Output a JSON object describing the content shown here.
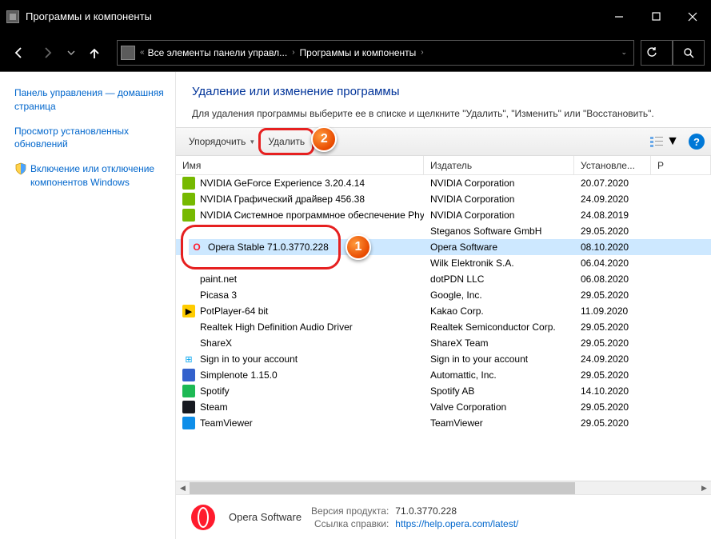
{
  "window": {
    "title": "Программы и компоненты"
  },
  "breadcrumb": {
    "item1": "Все элементы панели управл...",
    "item2": "Программы и компоненты"
  },
  "sidebar": {
    "item0": "Панель управления — домашняя страница",
    "item1": "Просмотр установленных обновлений",
    "item2": "Включение или отключение компонентов Windows"
  },
  "header": {
    "title": "Удаление или изменение программы",
    "desc": "Для удаления программы выберите ее в списке и щелкните \"Удалить\", \"Изменить\" или \"Восстановить\"."
  },
  "toolbar": {
    "organize": "Упорядочить",
    "delete": "Удалить"
  },
  "columns": {
    "name": "Имя",
    "publisher": "Издатель",
    "installed": "Установле...",
    "r": "Р"
  },
  "programs": [
    {
      "name": "NVIDIA GeForce Experience 3.20.4.14",
      "publisher": "NVIDIA Corporation",
      "date": "20.07.2020",
      "iconBg": "#76b900",
      "iconTxt": "",
      "iconColor": "#fff"
    },
    {
      "name": "NVIDIA Графический драйвер 456.38",
      "publisher": "NVIDIA Corporation",
      "date": "24.09.2020",
      "iconBg": "#76b900",
      "iconTxt": "",
      "iconColor": "#fff"
    },
    {
      "name": "NVIDIA Системное программное обеспечение Phy...",
      "publisher": "NVIDIA Corporation",
      "date": "24.08.2019",
      "iconBg": "#76b900",
      "iconTxt": "",
      "iconColor": "#fff"
    },
    {
      "name": "",
      "publisher": "Steganos Software GmbH",
      "date": "29.05.2020",
      "iconBg": "#ffffff",
      "iconTxt": "",
      "iconColor": "#000",
      "obscured": true
    },
    {
      "name": "Opera Stable 71.0.3770.228",
      "publisher": "Opera Software",
      "date": "08.10.2020",
      "iconBg": "#ffffff",
      "iconTxt": "O",
      "iconColor": "#ff1b2d",
      "selected": true
    },
    {
      "name": "",
      "publisher": "Wilk Elektronik S.A.",
      "date": "06.04.2020",
      "iconBg": "#ffffff",
      "iconTxt": "",
      "iconColor": "#000",
      "obscured": true
    },
    {
      "name": "paint.net",
      "publisher": "dotPDN LLC",
      "date": "06.08.2020",
      "iconBg": "#ffffff",
      "iconTxt": "",
      "iconColor": "#3a6ea5"
    },
    {
      "name": "Picasa 3",
      "publisher": "Google, Inc.",
      "date": "29.05.2020",
      "iconBg": "#ffffff",
      "iconTxt": "",
      "iconColor": "#f4b400"
    },
    {
      "name": "PotPlayer-64 bit",
      "publisher": "Kakao Corp.",
      "date": "11.09.2020",
      "iconBg": "#ffcc00",
      "iconTxt": "▶",
      "iconColor": "#000"
    },
    {
      "name": "Realtek High Definition Audio Driver",
      "publisher": "Realtek Semiconductor Corp.",
      "date": "29.05.2020",
      "iconBg": "#ffffff",
      "iconTxt": "",
      "iconColor": "#8a6d3b"
    },
    {
      "name": "ShareX",
      "publisher": "ShareX Team",
      "date": "29.05.2020",
      "iconBg": "#ffffff",
      "iconTxt": "",
      "iconColor": "#ff5722"
    },
    {
      "name": "Sign in to your account",
      "publisher": "Sign in to your account",
      "date": "24.09.2020",
      "iconBg": "#ffffff",
      "iconTxt": "⊞",
      "iconColor": "#00a4ef"
    },
    {
      "name": "Simplenote 1.15.0",
      "publisher": "Automattic, Inc.",
      "date": "29.05.2020",
      "iconBg": "#3361cc",
      "iconTxt": "",
      "iconColor": "#fff"
    },
    {
      "name": "Spotify",
      "publisher": "Spotify AB",
      "date": "14.10.2020",
      "iconBg": "#1db954",
      "iconTxt": "",
      "iconColor": "#fff"
    },
    {
      "name": "Steam",
      "publisher": "Valve Corporation",
      "date": "29.05.2020",
      "iconBg": "#171a21",
      "iconTxt": "",
      "iconColor": "#fff"
    },
    {
      "name": "TeamViewer",
      "publisher": "TeamViewer",
      "date": "29.05.2020",
      "iconBg": "#0e8ee9",
      "iconTxt": "",
      "iconColor": "#fff"
    }
  ],
  "footer": {
    "vendor": "Opera Software",
    "version_label": "Версия продукта:",
    "version_value": "71.0.3770.228",
    "help_label": "Ссылка справки:",
    "help_value": "https://help.opera.com/latest/"
  },
  "callouts": {
    "one": "1",
    "two": "2"
  }
}
